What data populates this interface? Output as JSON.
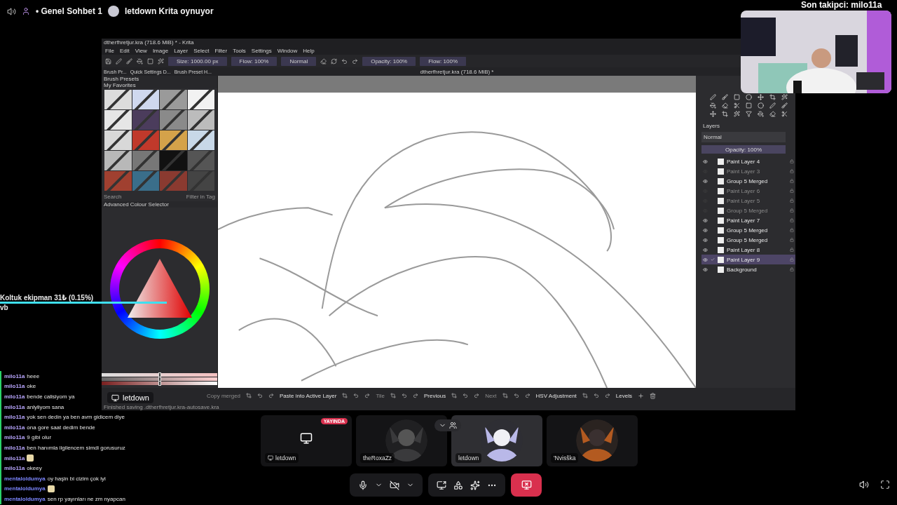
{
  "header": {
    "channel": "• Genel Sohbet 1",
    "activity": "letdown Krita oynuyor"
  },
  "krita": {
    "title": "dtherfhretjur.kra (718.6 MiB) * - Krita",
    "menu": [
      "File",
      "Edit",
      "View",
      "Image",
      "Layer",
      "Select",
      "Filter",
      "Tools",
      "Settings",
      "Window",
      "Help"
    ],
    "toolbar_fields": [
      "Size: 1000.00 px",
      "Flow: 100%",
      "Normal",
      "Opacity: 100%",
      "Flow: 100%"
    ],
    "docker_tabs": [
      "Brush Pr...",
      "Quick Settings D...",
      "Brush Preset H..."
    ],
    "document_tab": "dtherfhretjur.kra (718.6 MiB) *",
    "brush_presets": {
      "title": "Brush Presets",
      "tag": "My Favorites",
      "search": "Search",
      "filter": "Filter in Tag"
    },
    "color_selector": {
      "title": "Advanced Colour Selector",
      "sliders": [
        {
          "level": 0.5
        },
        {
          "level": 0.5
        },
        {
          "level": 0.5
        }
      ]
    },
    "layers": {
      "title": "Layers",
      "blend": "Normal",
      "opacity": "Opacity: 100%",
      "level": 1,
      "items": [
        {
          "name": "Paint Layer 4",
          "visible": true,
          "selected": false
        },
        {
          "name": "Paint Layer 3",
          "visible": false,
          "selected": false
        },
        {
          "name": "Group 5 Merged",
          "visible": true,
          "selected": false
        },
        {
          "name": "Paint Layer 6",
          "visible": false,
          "selected": false
        },
        {
          "name": "Paint Layer 5",
          "visible": false,
          "selected": false
        },
        {
          "name": "Group 5 Merged",
          "visible": false,
          "selected": false
        },
        {
          "name": "Paint Layer 7",
          "visible": true,
          "selected": false
        },
        {
          "name": "Group 5 Merged",
          "visible": true,
          "selected": false
        },
        {
          "name": "Group 5 Merged",
          "visible": true,
          "selected": false
        },
        {
          "name": "Paint Layer 8",
          "visible": true,
          "selected": false
        },
        {
          "name": "Paint Layer 9",
          "visible": true,
          "selected": true
        },
        {
          "name": "Background",
          "visible": true,
          "selected": false
        }
      ]
    },
    "bottom_toolbar": [
      {
        "label": "Copy merged",
        "disabled": true
      },
      {
        "label": "Paste into Active Layer",
        "disabled": false
      },
      {
        "label": "Tile",
        "disabled": true
      },
      {
        "label": "Previous",
        "disabled": false
      },
      {
        "label": "Next",
        "disabled": true
      },
      {
        "label": "HSV Adjustment",
        "disabled": false
      },
      {
        "label": "Levels",
        "disabled": false
      }
    ],
    "status": "Finished saving .dtherfhretjur.kra-autosave.kra"
  },
  "overlay": {
    "goal": "Koltuk ekipman   31₺ (0.15%)",
    "goal_note": "vb",
    "follower": "Son takipci: milo11a"
  },
  "chat": [
    {
      "user": "milo11a",
      "color": "#b9a6ff",
      "text": "heee"
    },
    {
      "user": "milo11a",
      "color": "#b9a6ff",
      "text": "oke"
    },
    {
      "user": "milo11a",
      "color": "#b9a6ff",
      "text": "bende calisiyom ya"
    },
    {
      "user": "milo11a",
      "color": "#b9a6ff",
      "text": "anlyliyom sana"
    },
    {
      "user": "milo11a",
      "color": "#b9a6ff",
      "text": "yok sen dedin ya ben avm gidicem diye"
    },
    {
      "user": "milo11a",
      "color": "#b9a6ff",
      "text": "ona gore saat dedim bende"
    },
    {
      "user": "milo11a",
      "color": "#b9a6ff",
      "text": "9 gibi olur"
    },
    {
      "user": "milo11a",
      "color": "#b9a6ff",
      "text": "ben hanımla ilgilencem simdi gorusuruz"
    },
    {
      "user": "milo11a",
      "color": "#b9a6ff",
      "kind": "emote"
    },
    {
      "user": "milo11a",
      "color": "#b9a6ff",
      "text": "okeey"
    },
    {
      "user": "mentaloldumya",
      "color": "#7c86ff",
      "text": "oy haşin bi cizim çok iyi"
    },
    {
      "user": "mentaloldumya",
      "color": "#7c86ff",
      "kind": "emote"
    },
    {
      "user": "mentaloldumya",
      "color": "#7c86ff",
      "text": "sen rp yayınları ne zm nyapcan"
    }
  ],
  "stream_label": "letdown",
  "tiles": [
    {
      "name": "letdown",
      "kind": "stream",
      "badge": "YAYINDA"
    },
    {
      "name": "theRoxaZz",
      "kind": "avatar"
    },
    {
      "name": "letdown",
      "kind": "avatar_focus"
    },
    {
      "name": "'Nvisška",
      "kind": "avatar"
    }
  ]
}
